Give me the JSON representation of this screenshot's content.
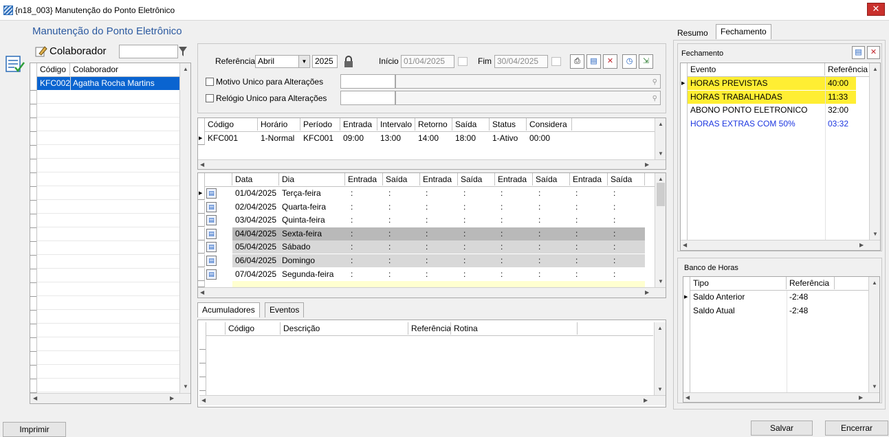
{
  "window": {
    "title": "{n18_003} Manutenção do Ponto Eletrônico",
    "form_title": "Manutenção do Ponto Eletrônico",
    "close_glyph": "✕"
  },
  "collaborator_panel": {
    "label": "Colaborador",
    "headers": [
      "Código",
      "Colaborador"
    ],
    "rows": [
      {
        "code": "KFC002",
        "name": "Agatha Rocha Martins"
      }
    ]
  },
  "filters": {
    "referencia_label": "Referência",
    "month": "Abril",
    "year": "2025",
    "inicio_label": "Início",
    "inicio_value": "01/04/2025",
    "fim_label": "Fim",
    "fim_value": "30/04/2025",
    "motivo_label": "Motivo Unico para Alterações",
    "relogio_label": "Relógio Unico para Alterações"
  },
  "schedule": {
    "headers": [
      "Código",
      "Horário",
      "Período",
      "Entrada",
      "Intervalo",
      "Retorno",
      "Saída",
      "Status",
      "Considera"
    ],
    "row": [
      "KFC001",
      "1-Normal",
      "KFC001",
      "09:00",
      "13:00",
      "14:00",
      "18:00",
      "1-Ativo",
      "00:00"
    ]
  },
  "days": {
    "headers": [
      "Data",
      "Dia",
      "Entrada",
      "Saída",
      "Entrada",
      "Saída",
      "Entrada",
      "Saída",
      "Entrada",
      "Saída"
    ],
    "placeholder": ":",
    "rows": [
      {
        "date": "01/04/2025",
        "day": "Terça-feira"
      },
      {
        "date": "02/04/2025",
        "day": "Quarta-feira"
      },
      {
        "date": "03/04/2025",
        "day": "Quinta-feira"
      },
      {
        "date": "04/04/2025",
        "day": "Sexta-feira"
      },
      {
        "date": "05/04/2025",
        "day": "Sábado"
      },
      {
        "date": "06/04/2025",
        "day": "Domingo"
      },
      {
        "date": "07/04/2025",
        "day": "Segunda-feira"
      }
    ]
  },
  "bottom_tabs": [
    "Acumuladores",
    "Eventos"
  ],
  "acumuladores": {
    "headers": [
      "Código",
      "Descrição",
      "Referência",
      "Rotina"
    ]
  },
  "right_tabs": [
    "Resumo",
    "Fechamento"
  ],
  "fechamento": {
    "title": "Fechamento",
    "headers": [
      "Evento",
      "Referência"
    ],
    "rows": [
      {
        "evento": "HORAS PREVISTAS",
        "ref": "40:00",
        "style": "yellow"
      },
      {
        "evento": "HORAS TRABALHADAS",
        "ref": "11:33",
        "style": "yellow"
      },
      {
        "evento": "ABONO PONTO ELETRONICO",
        "ref": "32:00",
        "style": "normal"
      },
      {
        "evento": "HORAS EXTRAS COM 50%",
        "ref": "03:32",
        "style": "blue"
      }
    ]
  },
  "banco": {
    "title": "Banco de Horas",
    "headers": [
      "Tipo",
      "Referência"
    ],
    "rows": [
      {
        "tipo": "Saldo Anterior",
        "ref": "-2:48"
      },
      {
        "tipo": "Saldo Atual",
        "ref": "-2:48"
      }
    ]
  },
  "footer": {
    "imprimir": "Imprimir",
    "salvar": "Salvar",
    "encerrar": "Encerrar"
  }
}
